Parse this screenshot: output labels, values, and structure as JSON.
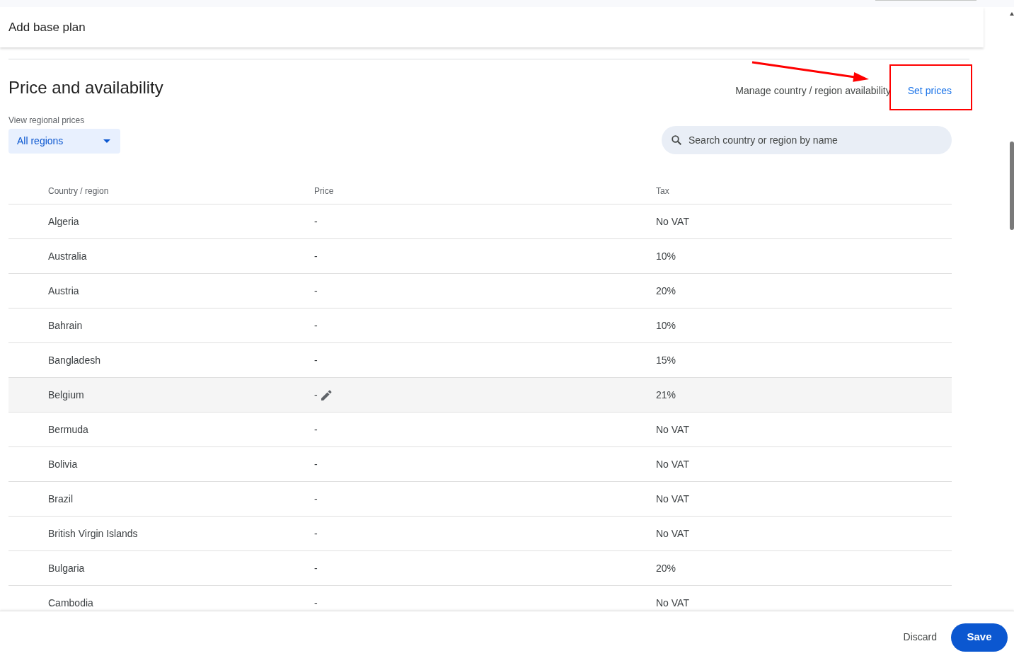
{
  "header": {
    "title": "Add base plan"
  },
  "section": {
    "title": "Price and availability",
    "links": [
      {
        "label": "Manage country / region availability",
        "kind": "secondary",
        "highlighted": false
      },
      {
        "label": "Set prices",
        "kind": "primary",
        "highlighted": true
      }
    ]
  },
  "region_filter": {
    "label": "View regional prices",
    "value": "All regions"
  },
  "search": {
    "placeholder": "Search country or region by name"
  },
  "table": {
    "columns": [
      "Country / region",
      "Price",
      "Tax"
    ],
    "rows": [
      {
        "country": "Algeria",
        "price": "-",
        "tax": "No VAT",
        "hovered": false
      },
      {
        "country": "Australia",
        "price": "-",
        "tax": "10%",
        "hovered": false
      },
      {
        "country": "Austria",
        "price": "-",
        "tax": "20%",
        "hovered": false
      },
      {
        "country": "Bahrain",
        "price": "-",
        "tax": "10%",
        "hovered": false
      },
      {
        "country": "Bangladesh",
        "price": "-",
        "tax": "15%",
        "hovered": false
      },
      {
        "country": "Belgium",
        "price": "-",
        "tax": "21%",
        "hovered": true
      },
      {
        "country": "Bermuda",
        "price": "-",
        "tax": "No VAT",
        "hovered": false
      },
      {
        "country": "Bolivia",
        "price": "-",
        "tax": "No VAT",
        "hovered": false
      },
      {
        "country": "Brazil",
        "price": "-",
        "tax": "No VAT",
        "hovered": false
      },
      {
        "country": "British Virgin Islands",
        "price": "-",
        "tax": "No VAT",
        "hovered": false
      },
      {
        "country": "Bulgaria",
        "price": "-",
        "tax": "20%",
        "hovered": false
      },
      {
        "country": "Cambodia",
        "price": "-",
        "tax": "No VAT",
        "hovered": false
      }
    ]
  },
  "footer": {
    "buttons": [
      {
        "label": "Discard",
        "kind": "text"
      },
      {
        "label": "Save",
        "kind": "filled"
      }
    ]
  }
}
